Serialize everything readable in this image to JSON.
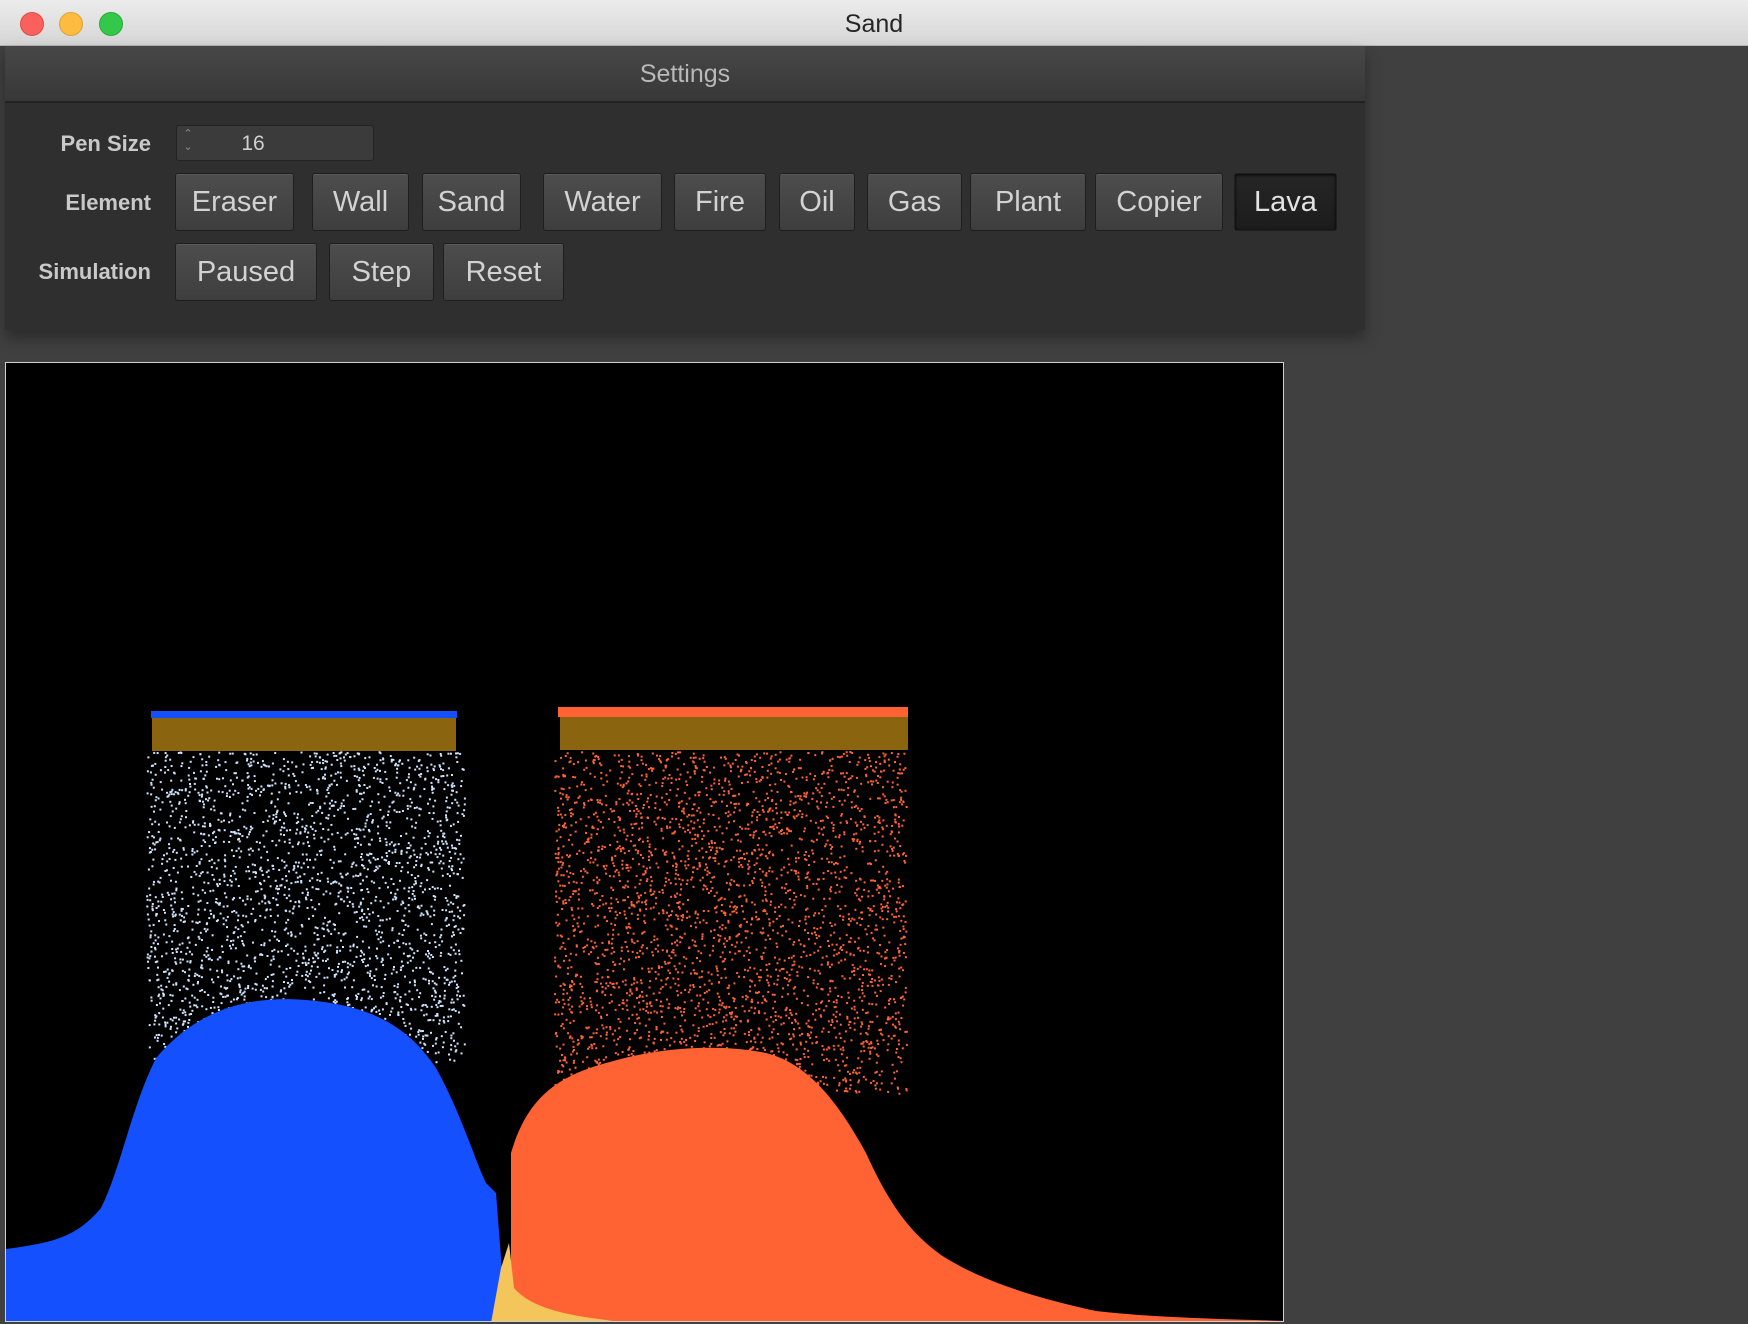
{
  "window": {
    "title": "Sand"
  },
  "settings": {
    "title": "Settings",
    "pen_size": {
      "label": "Pen Size",
      "value": "16"
    },
    "element": {
      "label": "Element",
      "options": [
        "Eraser",
        "Wall",
        "Sand",
        "Water",
        "Fire",
        "Oil",
        "Gas",
        "Plant",
        "Copier",
        "Lava"
      ],
      "selected": "Lava"
    },
    "simulation": {
      "label": "Simulation",
      "buttons": [
        "Paused",
        "Step",
        "Reset"
      ]
    }
  },
  "canvas": {
    "colors": {
      "background": "#000000",
      "water": "#1550ff",
      "lava": "#ff6333",
      "wall": "#8b6410",
      "sand": "#f4c55a",
      "water_drops": "#cfe4ff"
    }
  }
}
